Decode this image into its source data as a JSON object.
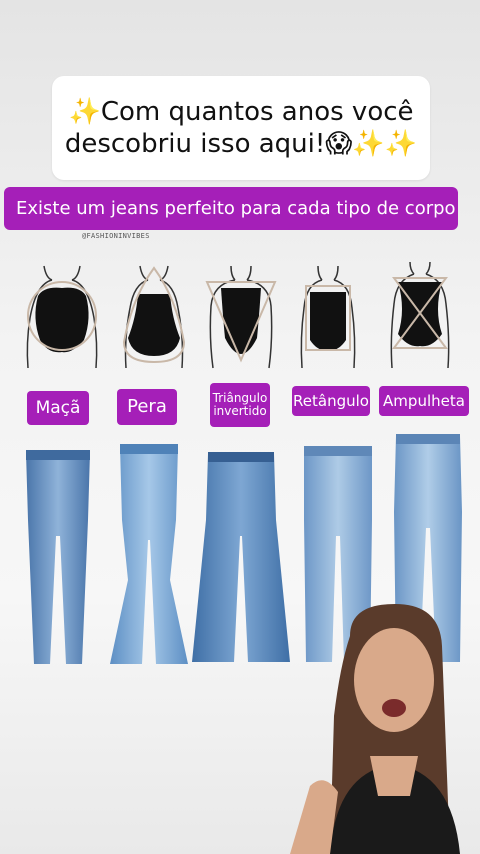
{
  "caption": {
    "line1": "✨Com quantos anos você",
    "line2": "descobriu isso aqui!😱✨✨"
  },
  "banner": {
    "text": "Existe um  jeans perfeito para cada tipo de corpo"
  },
  "credit": "@FASHIONINVIBES",
  "body_types": [
    {
      "label": "Maçã"
    },
    {
      "label": "Pera"
    },
    {
      "label_line1": "Triângulo",
      "label_line2": "invertido"
    },
    {
      "label": "Retângulo"
    },
    {
      "label": "Ampulheta"
    }
  ],
  "colors": {
    "accent": "#a51fb8",
    "denim_light": "#8fb3d9",
    "denim_dark": "#4a75aa"
  }
}
